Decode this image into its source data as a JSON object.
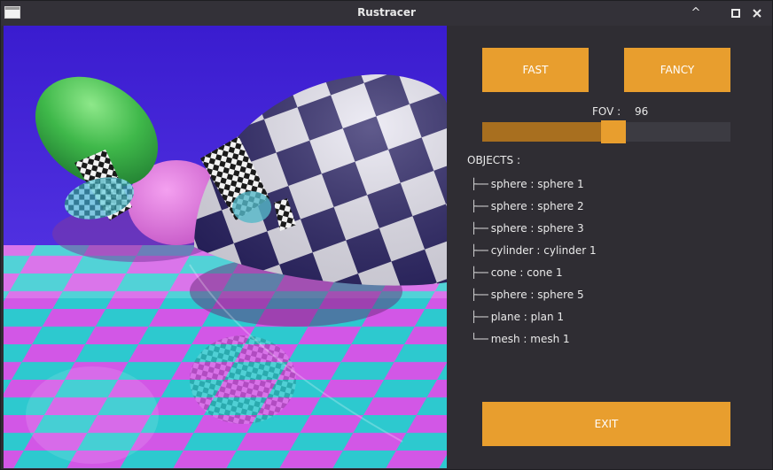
{
  "window": {
    "title": "Rustracer",
    "controls": {
      "minimize": "^",
      "maximize": "□",
      "close": "✕"
    }
  },
  "render": {
    "colors": {
      "sky": "#3a1fd0",
      "floor_magenta": "#d257e6",
      "floor_cyan": "#2dc9cf"
    }
  },
  "panel": {
    "fast_label": "FAST",
    "fancy_label": "FANCY",
    "fov_label": "FOV :",
    "fov_value": "96",
    "fov_fraction": 0.53,
    "objects_title": "OBJECTS :",
    "objects": [
      {
        "branch": "├──",
        "label": "sphere : sphere 1"
      },
      {
        "branch": "├──",
        "label": "sphere : sphere 2"
      },
      {
        "branch": "├──",
        "label": "sphere : sphere 3"
      },
      {
        "branch": "├──",
        "label": "cylinder : cylinder 1"
      },
      {
        "branch": "├──",
        "label": "cone : cone 1"
      },
      {
        "branch": "├──",
        "label": "sphere : sphere 5"
      },
      {
        "branch": "├──",
        "label": "plane : plan 1"
      },
      {
        "branch": "└──",
        "label": "mesh : mesh 1"
      }
    ],
    "exit_label": "EXIT",
    "accent": "#e89e2e"
  }
}
